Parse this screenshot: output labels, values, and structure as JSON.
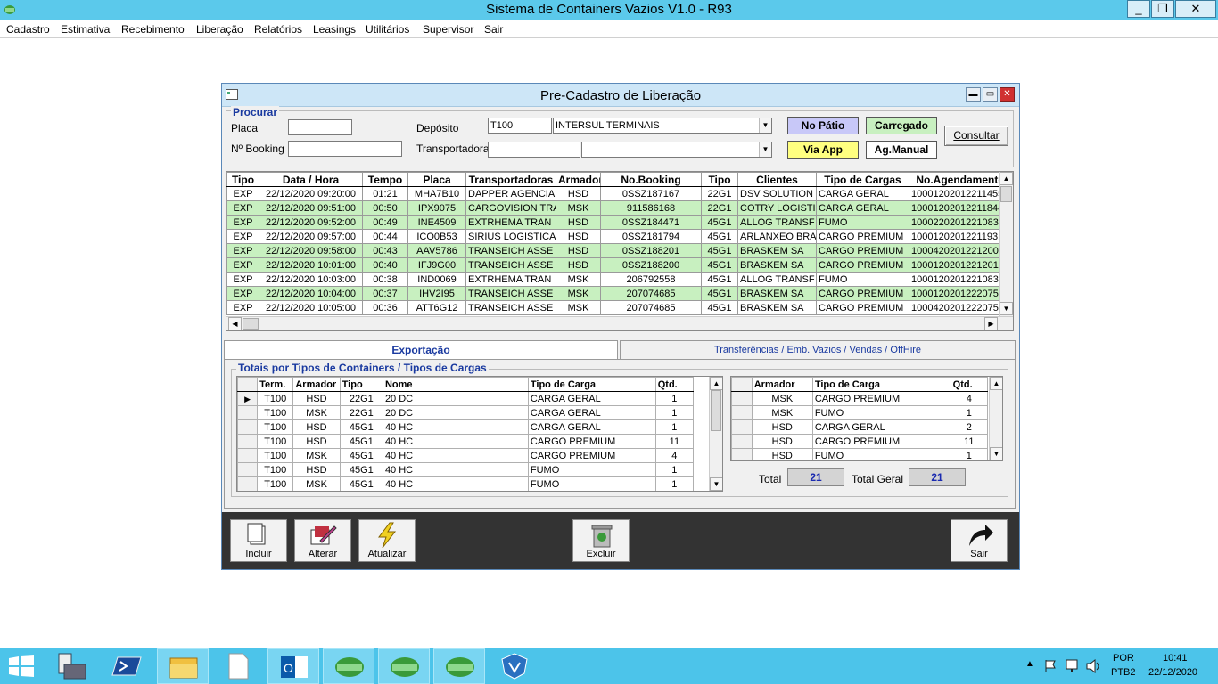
{
  "app": {
    "title": "Sistema de Containers Vazios V1.0 - R93",
    "window_buttons": [
      "_",
      "❐",
      "✕"
    ]
  },
  "menu": [
    "Cadastro",
    "Estimativa",
    "Recebimento",
    "Liberação",
    "Relatórios",
    "Leasings",
    "Utilitários",
    "Supervisor",
    "Sair"
  ],
  "child": {
    "title": "Pre-Cadastro de Liberação",
    "search": {
      "group_label": "Procurar",
      "placa_label": "Placa",
      "placa_value": "",
      "booking_label": "Nº Booking",
      "booking_value": "",
      "deposito_label": "Depósito",
      "deposito_code": "T100",
      "deposito_name": "INTERSUL TERMINAIS",
      "transportadora_label": "Transportadora",
      "transportadora_code": "",
      "transportadora_name": ""
    },
    "legend": {
      "no_patio": "No Pátio",
      "carregado": "Carregado",
      "via_app": "Via App",
      "ag_manual": "Ag.Manual",
      "consultar": "Consultar"
    },
    "colors": {
      "no_patio": "#c8c8f8",
      "carregado": "#c8f0c0",
      "via_app": "#ffff80",
      "ag_manual": "#ffffff",
      "row_green": "#c8f0c0"
    },
    "grid": {
      "columns": [
        "Tipo",
        "Data / Hora",
        "Tempo",
        "Placa",
        "Transportadoras",
        "Armador",
        "No.Booking",
        "Tipo",
        "Clientes",
        "Tipo de Cargas",
        "No.Agendamento"
      ],
      "rows": [
        {
          "c": [
            "EXP",
            "22/12/2020 09:20:00",
            "01:21",
            "MHA7B10",
            "DAPPER AGENCIA",
            "HSD",
            "0SSZ187167",
            "22G1",
            "DSV SOLUTION",
            "CARGA GERAL",
            "10001202012211455"
          ],
          "g": false
        },
        {
          "c": [
            "EXP",
            "22/12/2020 09:51:00",
            "00:50",
            "IPX9075",
            "CARGOVISION TRA",
            "MSK",
            "911586168",
            "22G1",
            "COTRY LOGISTI",
            "CARGA GERAL",
            "10001202012211844"
          ],
          "g": true
        },
        {
          "c": [
            "EXP",
            "22/12/2020 09:52:00",
            "00:49",
            "INE4509",
            "EXTRHEMA TRAN",
            "HSD",
            "0SSZ184471",
            "45G1",
            "ALLOG TRANSF",
            "FUMO",
            "10002202012210832"
          ],
          "g": true
        },
        {
          "c": [
            "EXP",
            "22/12/2020 09:57:00",
            "00:44",
            "ICO0B53",
            "SIRIUS LOGISTICA",
            "HSD",
            "0SSZ181794",
            "45G1",
            "ARLANXEO BRA",
            "CARGO PREMIUM",
            "10001202012211931"
          ],
          "g": false
        },
        {
          "c": [
            "EXP",
            "22/12/2020 09:58:00",
            "00:43",
            "AAV5786",
            "TRANSEICH ASSE",
            "HSD",
            "0SSZ188201",
            "45G1",
            "BRASKEM SA",
            "CARGO PREMIUM",
            "10004202012212003"
          ],
          "g": true
        },
        {
          "c": [
            "EXP",
            "22/12/2020 10:01:00",
            "00:40",
            "IFJ9G00",
            "TRANSEICH ASSE",
            "HSD",
            "0SSZ188200",
            "45G1",
            "BRASKEM SA",
            "CARGO PREMIUM",
            "10001202012212012"
          ],
          "g": true
        },
        {
          "c": [
            "EXP",
            "22/12/2020 10:03:00",
            "00:38",
            "IND0069",
            "EXTRHEMA TRAN",
            "MSK",
            "206792558",
            "45G1",
            "ALLOG TRANSF",
            "FUMO",
            "10001202012210831"
          ],
          "g": false
        },
        {
          "c": [
            "EXP",
            "22/12/2020 10:04:00",
            "00:37",
            "IHV2I95",
            "TRANSEICH ASSE",
            "MSK",
            "207074685",
            "45G1",
            "BRASKEM SA",
            "CARGO PREMIUM",
            "10001202012220752"
          ],
          "g": true
        },
        {
          "c": [
            "EXP",
            "22/12/2020 10:05:00",
            "00:36",
            "ATT6G12",
            "TRANSEICH ASSE",
            "MSK",
            "207074685",
            "45G1",
            "BRASKEM SA",
            "CARGO PREMIUM",
            "10004202012220752"
          ],
          "g": false
        }
      ]
    },
    "tabs": [
      "Exportação",
      "Transferências / Emb. Vazios / Vendas / OffHire"
    ],
    "totals": {
      "group_label": "Totais por Tipos de Containers / Tipos de Cargas",
      "left_columns": [
        "Term.",
        "Armador",
        "Tipo",
        "Nome",
        "Tipo de Carga",
        "Qtd."
      ],
      "left_rows": [
        [
          "T100",
          "HSD",
          "22G1",
          "20 DC",
          "CARGA GERAL",
          "1"
        ],
        [
          "T100",
          "MSK",
          "22G1",
          "20 DC",
          "CARGA GERAL",
          "1"
        ],
        [
          "T100",
          "HSD",
          "45G1",
          "40 HC",
          "CARGA GERAL",
          "1"
        ],
        [
          "T100",
          "HSD",
          "45G1",
          "40 HC",
          "CARGO PREMIUM",
          "11"
        ],
        [
          "T100",
          "MSK",
          "45G1",
          "40 HC",
          "CARGO PREMIUM",
          "4"
        ],
        [
          "T100",
          "HSD",
          "45G1",
          "40 HC",
          "FUMO",
          "1"
        ],
        [
          "T100",
          "MSK",
          "45G1",
          "40 HC",
          "FUMO",
          "1"
        ]
      ],
      "right_columns": [
        "Armador",
        "Tipo de Carga",
        "Qtd."
      ],
      "right_rows": [
        [
          "MSK",
          "CARGO PREMIUM",
          "4"
        ],
        [
          "MSK",
          "FUMO",
          "1"
        ],
        [
          "HSD",
          "CARGA GERAL",
          "2"
        ],
        [
          "HSD",
          "CARGO PREMIUM",
          "11"
        ],
        [
          "HSD",
          "FUMO",
          "1"
        ]
      ],
      "total_label": "Total",
      "total_value": "21",
      "total_geral_label": "Total Geral",
      "total_geral_value": "21"
    },
    "toolbar": {
      "incluir": "Incluir",
      "alterar": "Alterar",
      "atualizar": "Atualizar",
      "excluir": "Excluir",
      "sair": "Sair"
    }
  },
  "taskbar": {
    "lang1": "POR",
    "lang2": "PTB2",
    "time": "10:41",
    "date": "22/12/2020"
  }
}
